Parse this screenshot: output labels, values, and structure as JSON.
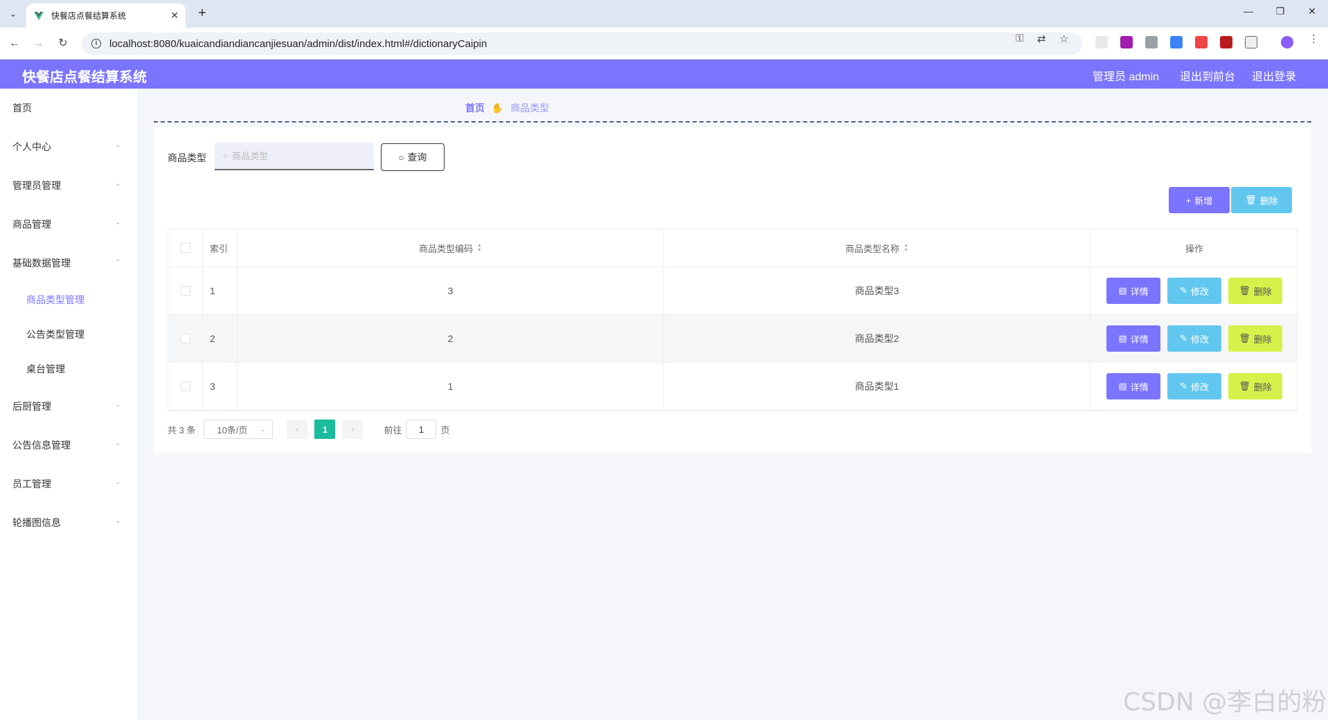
{
  "browser": {
    "tab_title": "快餐店点餐结算系统",
    "url": "localhost:8080/kuaicandiandiancanjiesuan/admin/dist/index.html#/dictionaryCaipin"
  },
  "header": {
    "app_title": "快餐店点餐结算系统",
    "admin_label": "管理员 admin",
    "to_front": "退出到前台",
    "logout": "退出登录"
  },
  "sidebar": {
    "items": [
      {
        "label": "首页"
      },
      {
        "label": "个人中心"
      },
      {
        "label": "管理员管理"
      },
      {
        "label": "商品管理"
      },
      {
        "label": "基础数据管理"
      },
      {
        "label": "商品类型管理"
      },
      {
        "label": "公告类型管理"
      },
      {
        "label": "桌台管理"
      },
      {
        "label": "后厨管理"
      },
      {
        "label": "公告信息管理"
      },
      {
        "label": "员工管理"
      },
      {
        "label": "轮播图信息"
      }
    ]
  },
  "breadcrumb": {
    "home": "首页",
    "current": "商品类型"
  },
  "search": {
    "label": "商品类型",
    "placeholder": "商品类型",
    "button": "查询"
  },
  "actions": {
    "add": "新增",
    "delete": "删除"
  },
  "table": {
    "headers": {
      "index": "索引",
      "code": "商品类型编码",
      "name": "商品类型名称",
      "ops": "操作"
    },
    "rows": [
      {
        "index": "1",
        "code": "3",
        "name": "商品类型3"
      },
      {
        "index": "2",
        "code": "2",
        "name": "商品类型2"
      },
      {
        "index": "3",
        "code": "1",
        "name": "商品类型1"
      }
    ],
    "op_labels": {
      "detail": "详情",
      "edit": "修改",
      "delete": "删除"
    }
  },
  "pagination": {
    "total": "共 3 条",
    "page_size": "10条/页",
    "current_page": "1",
    "goto_label": "前往",
    "goto_value": "1",
    "page_suffix": "页"
  },
  "watermark": "CSDN @李白的粉",
  "colors": {
    "primary": "#7b74ff",
    "info": "#62c7ee",
    "warning": "#d6f24a",
    "pager_active": "#1abc9c"
  }
}
